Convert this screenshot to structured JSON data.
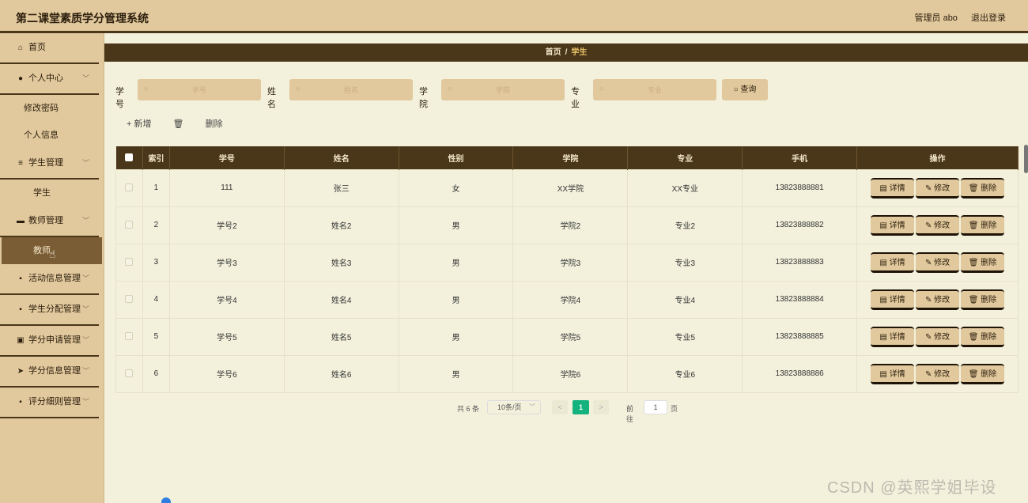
{
  "app": {
    "title": "第二课堂素质学分管理系统"
  },
  "header": {
    "user": "管理员 abo",
    "logout": "退出登录"
  },
  "sidebar": {
    "home": "首页",
    "personal": "个人中心",
    "change_password": "修改密码",
    "profile": "个人信息",
    "student_mgmt": "学生管理",
    "student": "学生",
    "teacher_mgmt": "教师管理",
    "teacher": "教师",
    "activity_mgmt": "活动信息管理",
    "allocation_mgmt": "学生分配管理",
    "credit_apply_mgmt": "学分申请管理",
    "credit_info_mgmt": "学分信息管理",
    "rules_mgmt": "评分细则管理"
  },
  "breadcrumb": {
    "home": "首页",
    "separator": "/",
    "current": "学生"
  },
  "search": {
    "id_label": "学号",
    "id_placeholder": "学号",
    "name_label": "姓名",
    "name_placeholder": "姓名",
    "college_label": "学院",
    "college_placeholder": "学院",
    "major_label": "专业",
    "major_placeholder": "专业",
    "query": "查询"
  },
  "toolbar": {
    "add": "+ 新增",
    "delete": "删除"
  },
  "table": {
    "headers": [
      "索引",
      "学号",
      "姓名",
      "性别",
      "学院",
      "专业",
      "手机",
      "操作"
    ],
    "rows": [
      [
        "1",
        "111",
        "张三",
        "女",
        "XX学院",
        "XX专业",
        "13823888881"
      ],
      [
        "2",
        "学号2",
        "姓名2",
        "男",
        "学院2",
        "专业2",
        "13823888882"
      ],
      [
        "3",
        "学号3",
        "姓名3",
        "男",
        "学院3",
        "专业3",
        "13823888883"
      ],
      [
        "4",
        "学号4",
        "姓名4",
        "男",
        "学院4",
        "专业4",
        "13823888884"
      ],
      [
        "5",
        "学号5",
        "姓名5",
        "男",
        "学院5",
        "专业5",
        "13823888885"
      ],
      [
        "6",
        "学号6",
        "姓名6",
        "男",
        "学院6",
        "专业6",
        "13823888886"
      ]
    ],
    "actions": {
      "detail": "详情",
      "edit": "修改",
      "delete": "删除"
    }
  },
  "pagination": {
    "total": "共 6 条",
    "page_size": "10条/页",
    "prev": "<",
    "current": "1",
    "next": ">",
    "goto": "前往",
    "goto_value": "1",
    "page_unit": "页"
  },
  "watermark": "CSDN @英熙学姐毕设",
  "colors": {
    "accent": "#4a3618",
    "panel": "#e1c89d",
    "background": "#f3f1dc",
    "pager_active": "#14b37d"
  }
}
